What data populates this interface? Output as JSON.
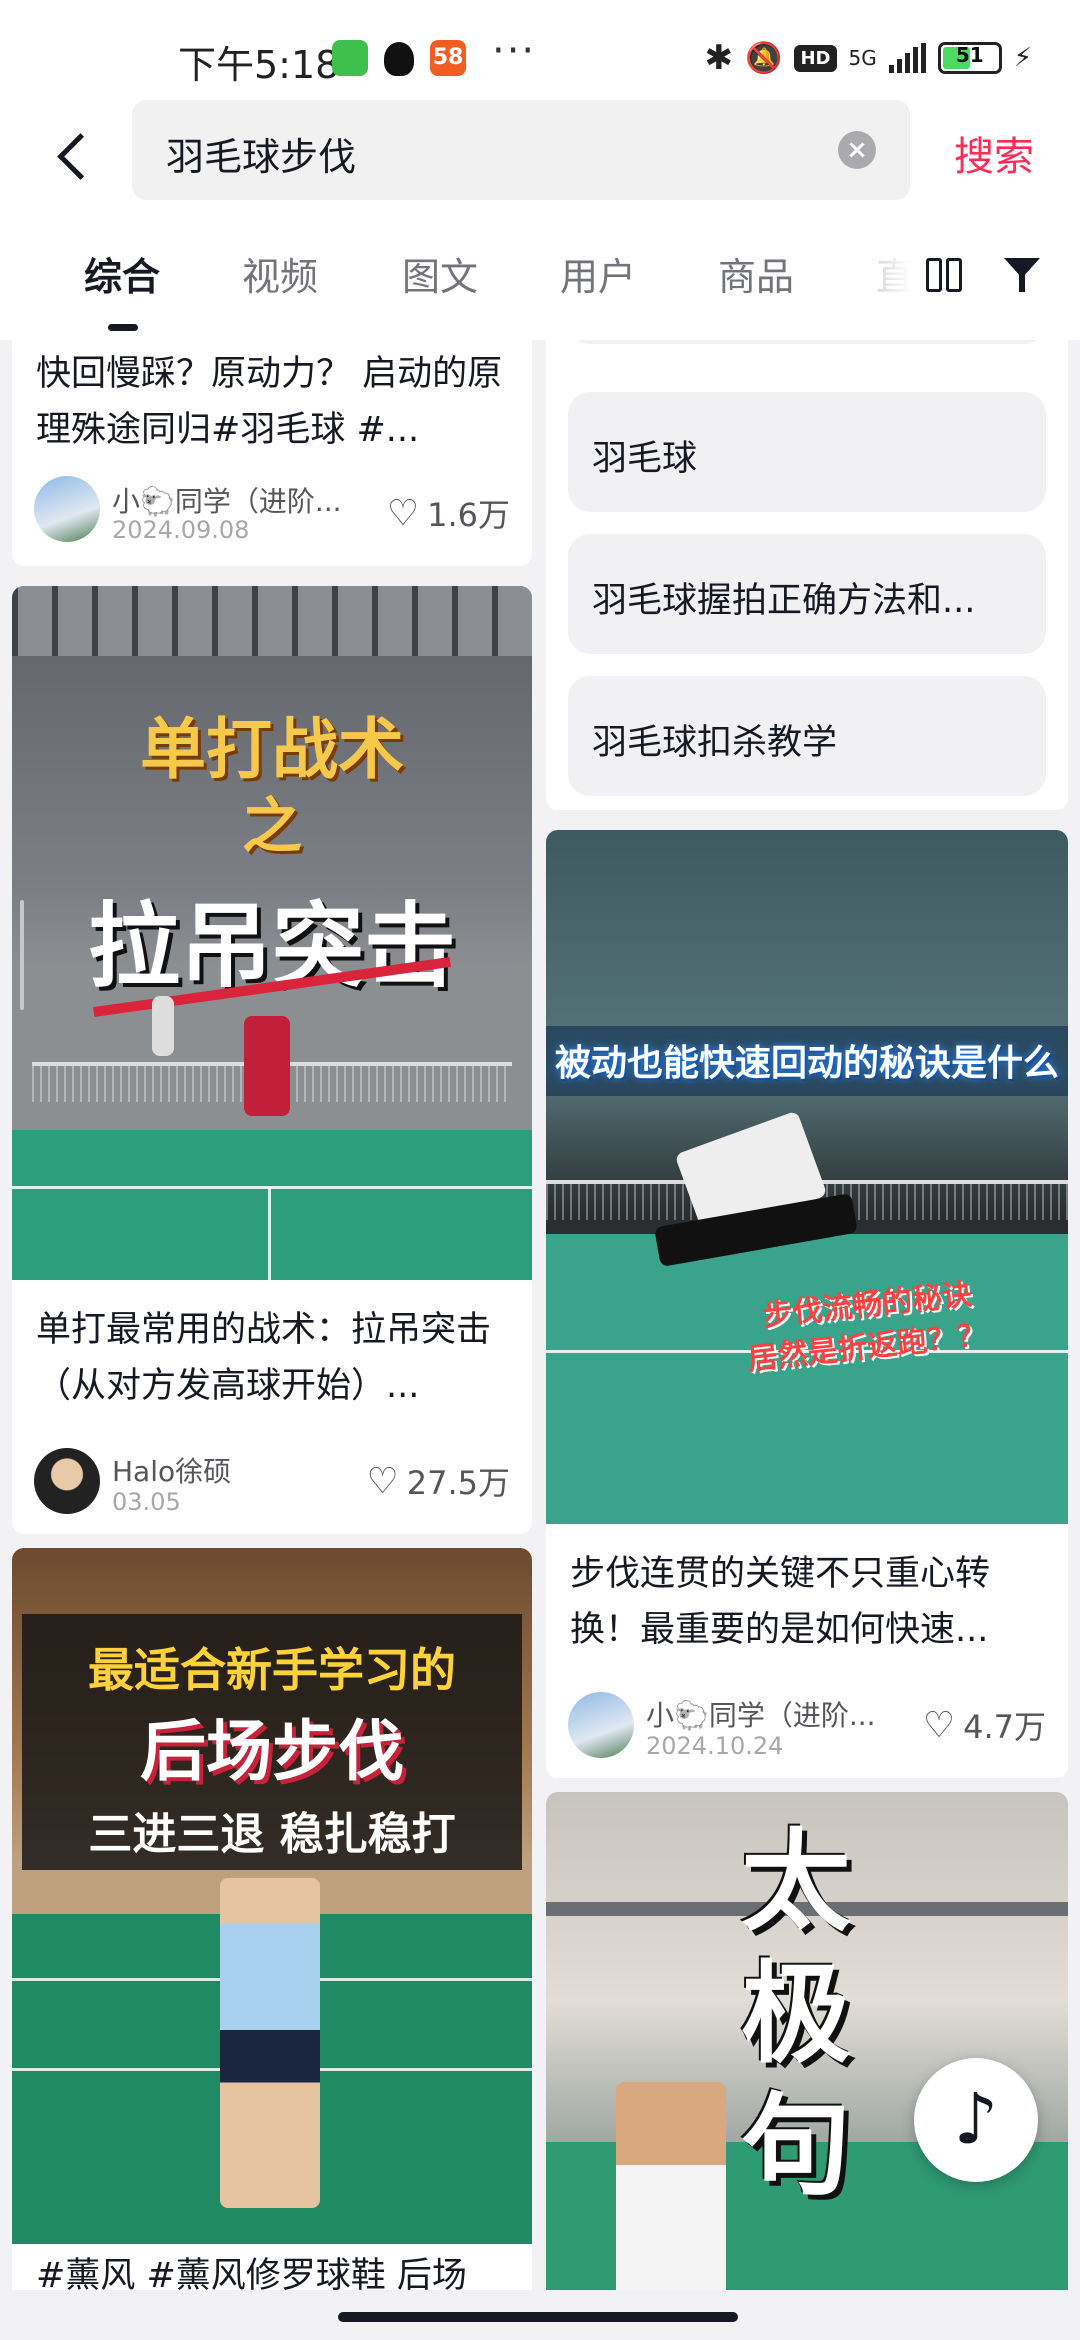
{
  "status_bar": {
    "time": "下午5:18",
    "app_58": "58",
    "more": "···",
    "hd": "HD",
    "network": "5G",
    "battery": "51",
    "battery_level": 0.51,
    "icons": [
      "wechat-icon",
      "qq-icon",
      "58-icon",
      "bluetooth-icon",
      "mute-bell-icon",
      "signal-icon",
      "battery-icon",
      "charging-icon"
    ]
  },
  "search": {
    "query": "羽毛球步伐",
    "submit_label": "搜索"
  },
  "tabs": [
    "综合",
    "视频",
    "图文",
    "用户",
    "商品",
    "直"
  ],
  "active_tab": "综合",
  "colors": {
    "accent": "#fe2c55",
    "text": "#161823",
    "muted": "#a6a7ab"
  },
  "feed": {
    "left": [
      {
        "title": "快回慢踩？原动力？ 启动的原理殊途同归#羽毛球 #...",
        "author": "小🐑同学（进阶...",
        "date": "2024.09.08",
        "likes": "1.6万"
      },
      {
        "overlay_line1": "单打战术",
        "overlay_line2": "之",
        "overlay_line3": "拉吊突击",
        "title": "单打最常用的战术：拉吊突击（从对方发高球开始）...",
        "author": "Halo徐硕",
        "date": "03.05",
        "likes": "27.5万"
      },
      {
        "overlay_line1": "最适合新手学习的",
        "overlay_line2": "后场步伐",
        "overlay_line3": "三进三退 稳扎稳打",
        "title": "#薰风 #薰风修罗球鞋 后场"
      }
    ],
    "right": {
      "suggestions": [
        "羽毛球",
        "羽毛球握拍正确方法和...",
        "羽毛球扣杀教学"
      ],
      "cards": [
        {
          "overlay_top": "被动也能快速回动的秘诀是什么",
          "overlay_mid1": "步伐流畅的秘诀",
          "overlay_mid2": "居然是折返跑？？",
          "title": "步伐连贯的关键不只重心转换！最重要的是如何快速...",
          "author": "小🐑同学（进阶...",
          "date": "2024.10.24",
          "likes": "4.7万"
        },
        {
          "overlay_line1": "太",
          "overlay_line2": "极",
          "overlay_line3": "句"
        }
      ]
    }
  },
  "floating_button": "♪"
}
